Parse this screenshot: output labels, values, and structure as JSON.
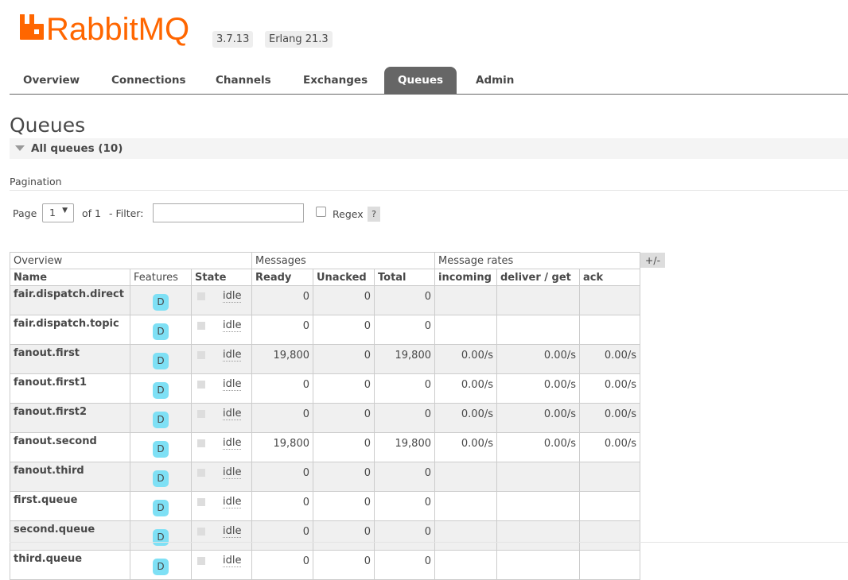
{
  "header": {
    "brand": "RabbitMQ",
    "version": "3.7.13",
    "erlang": "Erlang 21.3",
    "brand_color": "#f60"
  },
  "tabs": [
    "Overview",
    "Connections",
    "Channels",
    "Exchanges",
    "Queues",
    "Admin"
  ],
  "active_tab": "Queues",
  "page_title": "Queues",
  "section_label": "All queues (10)",
  "pagination": {
    "title": "Pagination",
    "page_label": "Page",
    "page_value": "1",
    "of_label": "of 1",
    "filter_label": "- Filter:",
    "filter_value": "",
    "regex_label": "Regex",
    "help": "?"
  },
  "table": {
    "groups": [
      "Overview",
      "Messages",
      "Message rates"
    ],
    "columns": [
      "Name",
      "Features",
      "State",
      "Ready",
      "Unacked",
      "Total",
      "incoming",
      "deliver / get",
      "ack"
    ],
    "plus_minus": "+/-",
    "rows": [
      {
        "name": "fair.dispatch.direct",
        "feature": "D",
        "state": "idle",
        "ready": "0",
        "unacked": "0",
        "total": "0",
        "incoming": "",
        "deliver": "",
        "ack": ""
      },
      {
        "name": "fair.dispatch.topic",
        "feature": "D",
        "state": "idle",
        "ready": "0",
        "unacked": "0",
        "total": "0",
        "incoming": "",
        "deliver": "",
        "ack": ""
      },
      {
        "name": "fanout.first",
        "feature": "D",
        "state": "idle",
        "ready": "19,800",
        "unacked": "0",
        "total": "19,800",
        "incoming": "0.00/s",
        "deliver": "0.00/s",
        "ack": "0.00/s"
      },
      {
        "name": "fanout.first1",
        "feature": "D",
        "state": "idle",
        "ready": "0",
        "unacked": "0",
        "total": "0",
        "incoming": "0.00/s",
        "deliver": "0.00/s",
        "ack": "0.00/s"
      },
      {
        "name": "fanout.first2",
        "feature": "D",
        "state": "idle",
        "ready": "0",
        "unacked": "0",
        "total": "0",
        "incoming": "0.00/s",
        "deliver": "0.00/s",
        "ack": "0.00/s"
      },
      {
        "name": "fanout.second",
        "feature": "D",
        "state": "idle",
        "ready": "19,800",
        "unacked": "0",
        "total": "19,800",
        "incoming": "0.00/s",
        "deliver": "0.00/s",
        "ack": "0.00/s"
      },
      {
        "name": "fanout.third",
        "feature": "D",
        "state": "idle",
        "ready": "0",
        "unacked": "0",
        "total": "0",
        "incoming": "",
        "deliver": "",
        "ack": ""
      },
      {
        "name": "first.queue",
        "feature": "D",
        "state": "idle",
        "ready": "0",
        "unacked": "0",
        "total": "0",
        "incoming": "",
        "deliver": "",
        "ack": ""
      },
      {
        "name": "second.queue",
        "feature": "D",
        "state": "idle",
        "ready": "0",
        "unacked": "0",
        "total": "0",
        "incoming": "",
        "deliver": "",
        "ack": ""
      },
      {
        "name": "third.queue",
        "feature": "D",
        "state": "idle",
        "ready": "0",
        "unacked": "0",
        "total": "0",
        "incoming": "",
        "deliver": "",
        "ack": ""
      }
    ]
  }
}
